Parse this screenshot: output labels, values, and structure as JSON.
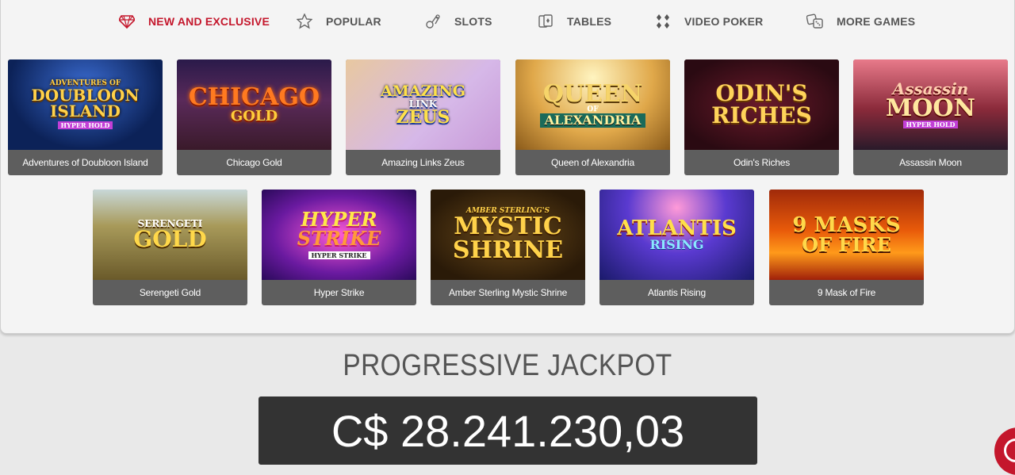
{
  "nav": {
    "tabs": [
      {
        "label": "NEW AND EXCLUSIVE",
        "icon": "diamond-icon",
        "active": true
      },
      {
        "label": "POPULAR",
        "icon": "star-icon",
        "active": false
      },
      {
        "label": "SLOTS",
        "icon": "slot-machine-icon",
        "active": false
      },
      {
        "label": "TABLES",
        "icon": "cards-icon",
        "active": false
      },
      {
        "label": "VIDEO POKER",
        "icon": "card-suits-icon",
        "active": false
      },
      {
        "label": "MORE GAMES",
        "icon": "dice-icon",
        "active": false
      }
    ]
  },
  "games": [
    {
      "title": "Adventures of Doubloon Island",
      "logo": [
        "ADVENTURES OF",
        "DOUBLOON",
        "ISLAND",
        "HYPER HOLD"
      ]
    },
    {
      "title": "Chicago Gold",
      "logo": [
        "CHICAGO",
        "GOLD"
      ]
    },
    {
      "title": "Amazing Links Zeus",
      "logo": [
        "AMAZING",
        "LINK",
        "ZEUS"
      ]
    },
    {
      "title": "Queen of Alexandria",
      "logo": [
        "QUEEN",
        "OF",
        "ALEXANDRIA"
      ]
    },
    {
      "title": "Odin's Riches",
      "logo": [
        "ODIN'S",
        "RICHES"
      ]
    },
    {
      "title": "Assassin Moon",
      "logo": [
        "Assassin",
        "MOON",
        "HYPER HOLD"
      ]
    },
    {
      "title": "Serengeti Gold",
      "logo": [
        "SERENGETI",
        "GOLD"
      ]
    },
    {
      "title": "Hyper Strike",
      "logo": [
        "HYPER",
        "STRIKE",
        "HYPER STRIKE"
      ]
    },
    {
      "title": "Amber Sterling Mystic Shrine",
      "logo": [
        "AMBER STERLING'S",
        "MYSTIC",
        "SHRINE"
      ]
    },
    {
      "title": "Atlantis Rising",
      "logo": [
        "ATLANTIS",
        "RISING"
      ]
    },
    {
      "title": "9 Mask of Fire",
      "logo": [
        "9 MASKS",
        "OF FIRE"
      ]
    }
  ],
  "jackpot": {
    "title": "PROGRESSIVE JACKPOT",
    "amount": "C$ 28.241.230,03"
  },
  "colors": {
    "accent": "#c4172c",
    "caption_bg": "#5e5e5e",
    "jackpot_bg": "#333333"
  }
}
